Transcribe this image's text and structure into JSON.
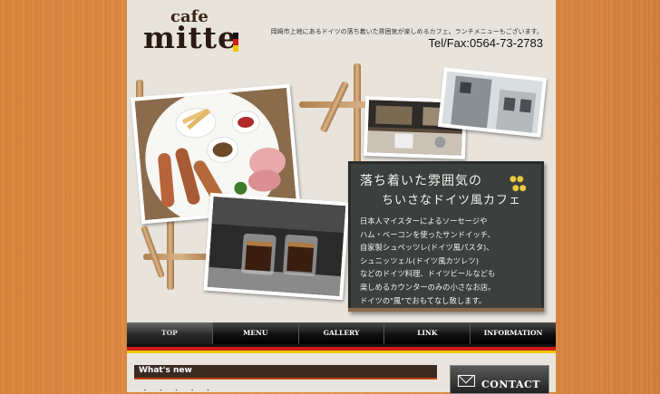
{
  "header": {
    "logo_cafe": "cafe",
    "logo_name": "mitte",
    "tagline": "岡崎市上地にあるドイツの落ち着いた雰囲気が楽しめるカフェ。ランチメニューもございます。",
    "tel": "Tel/Fax:0564-73-2783",
    "flag_colors": [
      "#111111",
      "#d01b1b",
      "#f0c400"
    ]
  },
  "board": {
    "title_line1": "落ち着いた雰囲気の",
    "title_line2": "ちいさなドイツ風カフェ",
    "body": [
      "日本人マイスターによるソーセージや",
      "ハム・ベーコンを使ったサンドイッチ、",
      "自家製シュペッツレ(ドイツ風パスタ)、",
      "シュニッツェル(ドイツ風カツレツ)",
      "などのドイツ料理、ドイツビールなども",
      "楽しめるカウンターのみの小さなお店。",
      "ドイツの\"風\"でおもてなし致します。"
    ]
  },
  "nav": {
    "items": [
      "TOP",
      "MENU",
      "GALLERY",
      "LINK",
      "INFORMATION"
    ],
    "active": "TOP"
  },
  "whats_new": {
    "heading": "What's new"
  },
  "contact": {
    "label": "CONTACT"
  }
}
